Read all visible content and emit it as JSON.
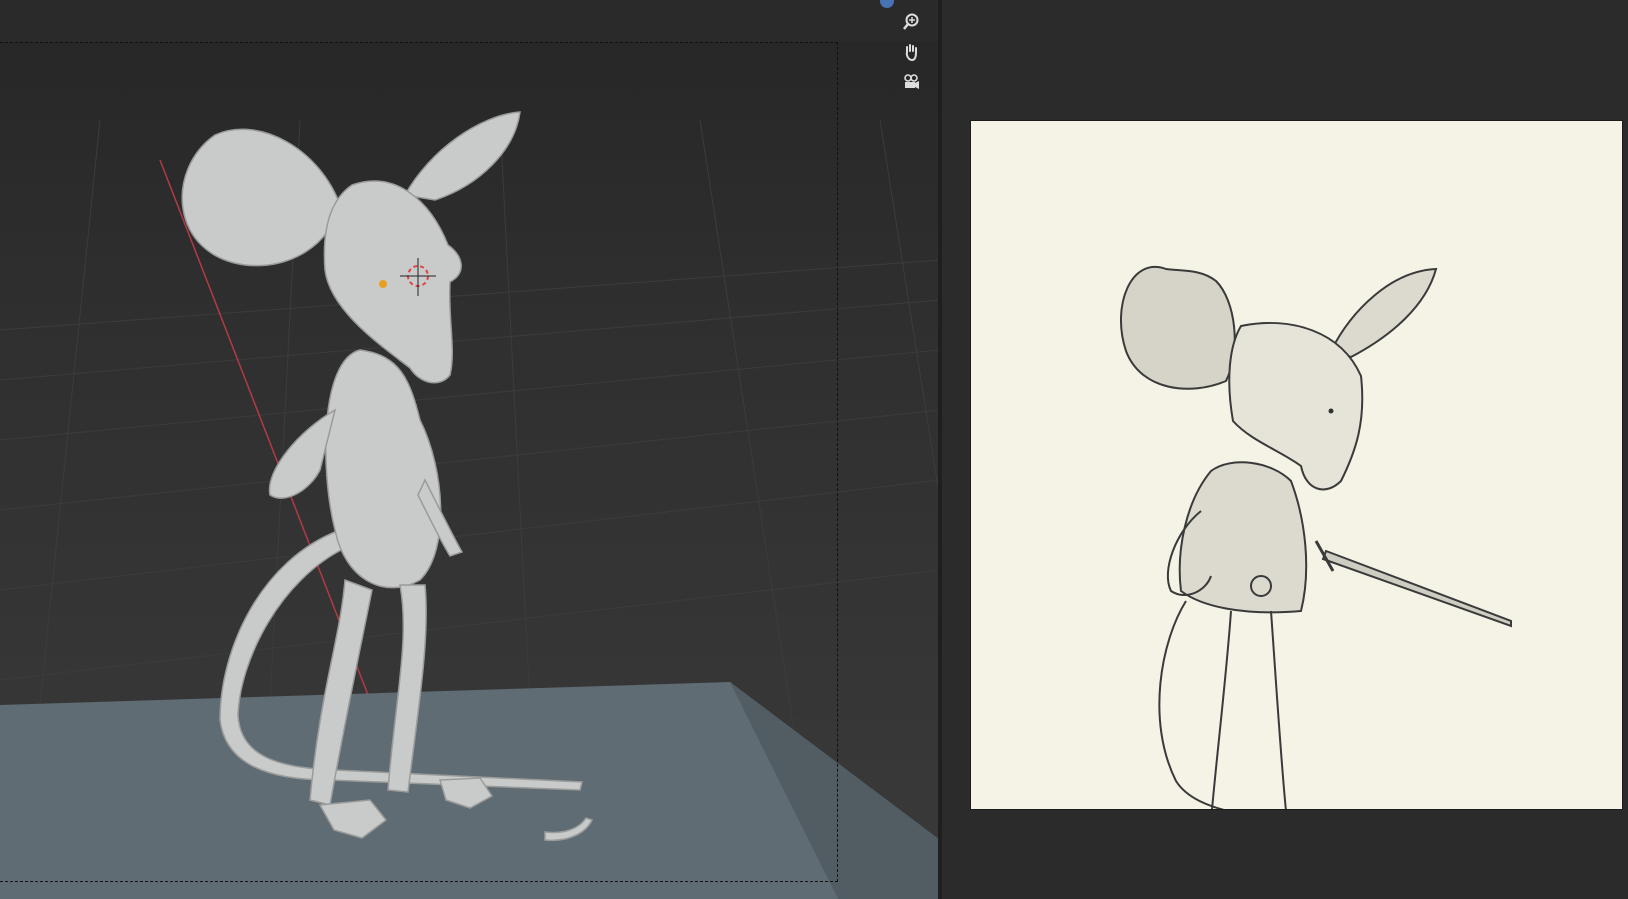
{
  "viewport": {
    "gizmos": [
      {
        "icon": "zoom-icon"
      },
      {
        "icon": "hand-pan-icon"
      },
      {
        "icon": "camera-view-icon"
      }
    ],
    "colors": {
      "floor": "#5f6c73",
      "model": "#c9cbca",
      "x_axis": "#b33a45"
    }
  },
  "image_editor": {
    "colors": {
      "paper": "#f5f3e6",
      "pencil": "#3a3a3a"
    }
  }
}
